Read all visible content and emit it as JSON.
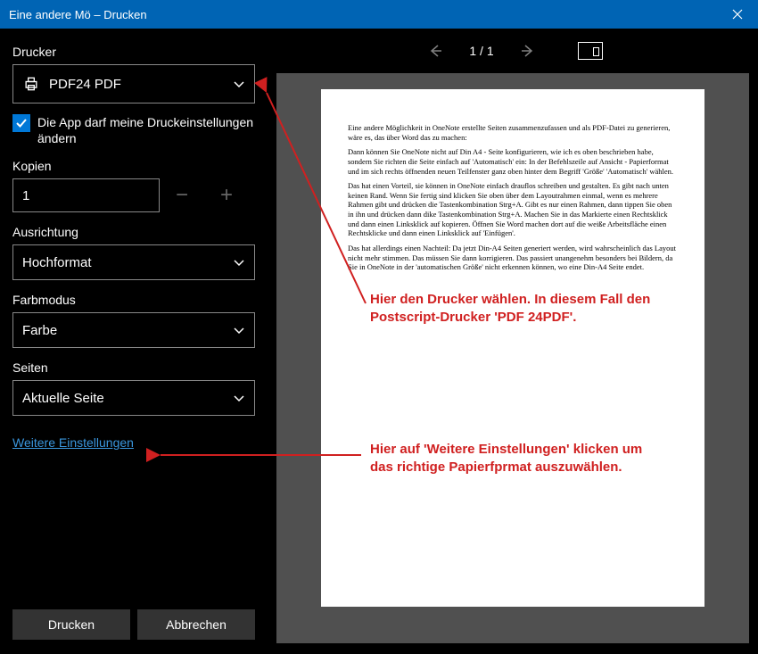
{
  "title": "Eine andere Mö – Drucken",
  "sidebar": {
    "printerLabel": "Drucker",
    "printerValue": "PDF24 PDF",
    "checkboxText": "Die App darf meine Druckeinstellungen ändern",
    "copiesLabel": "Kopien",
    "copiesValue": "1",
    "orientationLabel": "Ausrichtung",
    "orientationValue": "Hochformat",
    "colorLabel": "Farbmodus",
    "colorValue": "Farbe",
    "pagesLabel": "Seiten",
    "pagesValue": "Aktuelle Seite",
    "moreLink": "Weitere Einstellungen",
    "printBtn": "Drucken",
    "cancelBtn": "Abbrechen"
  },
  "previewBar": {
    "pageIndicator": "1  /  1"
  },
  "document": {
    "p1": "Eine andere Möglichkeit in OneNote erstellte Seiten zusammenzufassen und als PDF-Datei zu generieren, wäre es, das über Word das zu machen:",
    "p2": "Dann können Sie OneNote nicht auf Din A4 - Seite konfigurieren, wie ich es oben beschrieben habe, sondern Sie richten die Seite einfach auf 'Automatisch' ein: In der Befehlszeile auf Ansicht - Papierformat und im sich rechts öffnenden neuen Teilfenster ganz oben hinter dem Begriff 'Größe'  'Automatisch' wählen.",
    "p3": "Das hat einen Vorteil, sie können in OneNote einfach drauflos schreiben und gestalten. Es gibt nach unten keinen Rand. Wenn Sie fertig sind klicken Sie oben über dem Layoutrahmen einmal, wenn es mehrere Rahmen gibt und drücken die Tastenkombination Strg+A. Gibt es nur einen Rahmen, dann tippen Sie oben in ihn und drücken dann dike Tastenkombination Strg+A. Machen Sie in das Markierte einen Rechtsklick und dann einen Linksklick auf kopieren. Öffnen Sie Word machen dort auf die weiße Arbeitsfläche einen Rechtsklicke und dann einen Linksklick auf 'Einfügen'.",
    "p4": "Das hat allerdings einen Nachteil: Da jetzt Din-A4 Seiten generiert werden, wird wahrscheinlich das Layout nicht mehr stimmen. Das müssen Sie dann korrigieren. Das passiert unangenehm besonders bei Bildern, da Sie in OneNote in der 'automatischen Größe' nicht erkennen können, wo eine Din-A4 Seite endet."
  },
  "annotations": {
    "a1": "Hier den Drucker wählen. In diesem Fall den Postscript-Drucker 'PDF 24PDF'.",
    "a2": "Hier auf 'Weitere Einstellungen' klicken um das richtige Papierfprmat auszuwählen."
  }
}
